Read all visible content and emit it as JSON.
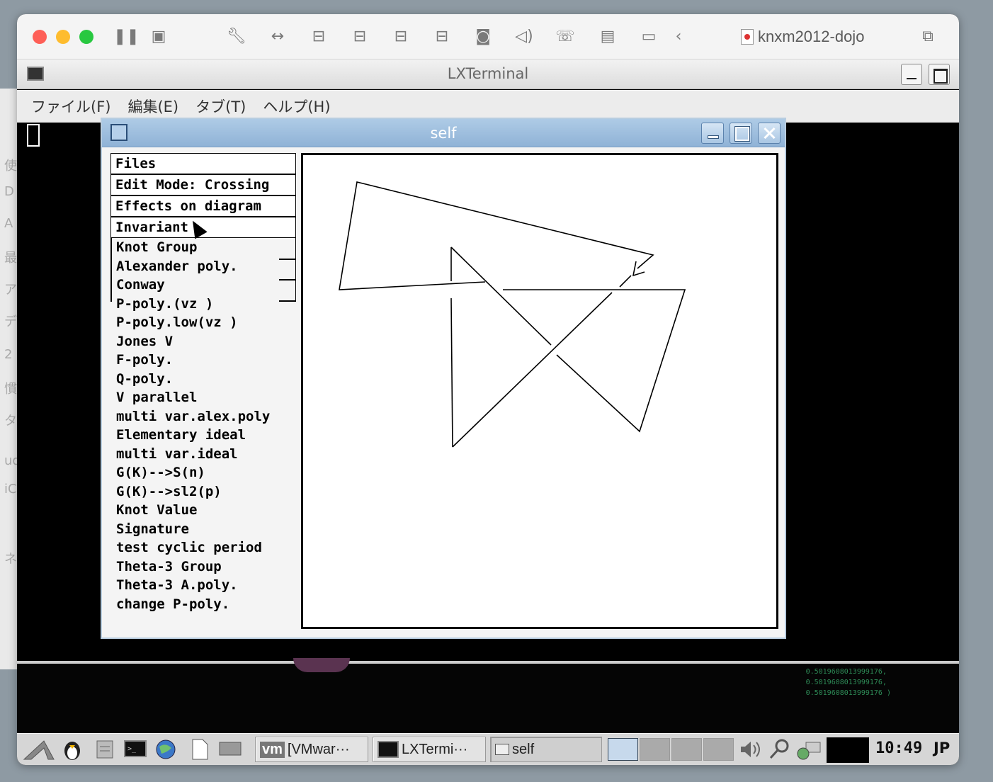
{
  "vm": {
    "title": "knxm2012-dojo",
    "toolbar_icons": [
      "pause-icon",
      "snapshot-icon",
      "wrench-icon",
      "arrows-icon",
      "disk-icon",
      "disk-icon",
      "disk-icon",
      "disk-icon",
      "camera-icon",
      "speaker-icon",
      "phone-icon",
      "floppy-icon",
      "folder-icon",
      "back-icon"
    ]
  },
  "terminal": {
    "title": "LXTerminal",
    "menu": [
      "ファイル(F)",
      "編集(E)",
      "タブ(T)",
      "ヘルプ(H)"
    ]
  },
  "self_window": {
    "title": "self",
    "buttons": [
      "Files",
      "Edit Mode: Crossing",
      "Effects on diagram",
      "Invariant"
    ],
    "submenu": [
      "Knot Group",
      "Alexander poly.",
      "Conway",
      "P-poly.(vz )",
      "P-poly.low(vz )",
      "Jones V",
      "F-poly.",
      "Q-poly.",
      "V parallel",
      "multi var.alex.poly",
      "Elementary ideal",
      "multi var.ideal",
      "G(K)-->S(n)",
      "G(K)-->sl2(p)",
      "Knot Value",
      "Signature",
      "test cyclic period",
      "Theta-3 Group",
      "Theta-3 A.poly.",
      "change P-poly."
    ]
  },
  "desktop": {
    "green_text": [
      "0.5019608013999176,",
      "0.5019608013999176,",
      "0.5019608013999176 )"
    ]
  },
  "taskbar": {
    "tasks": [
      "[VMwar···",
      "LXTermi···",
      "self"
    ],
    "clock": "10:49",
    "ime": "JP"
  }
}
